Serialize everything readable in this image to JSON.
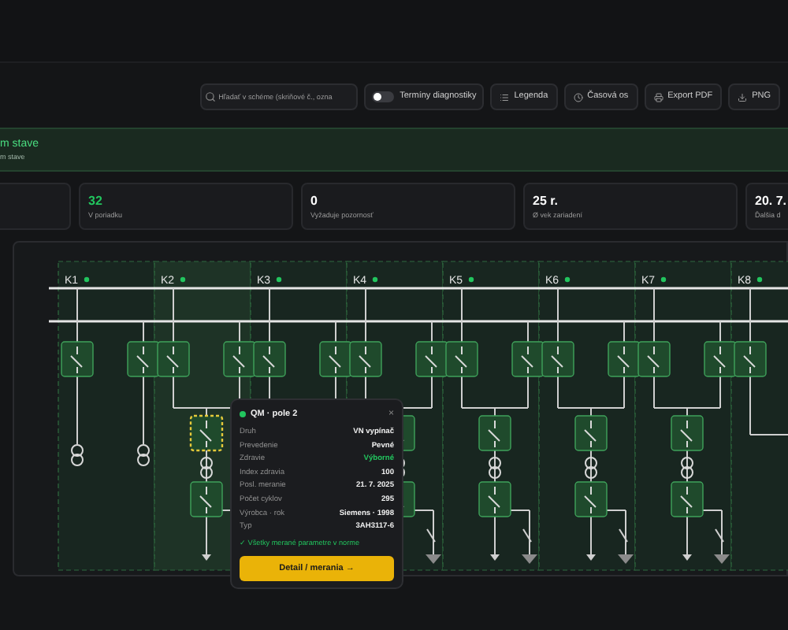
{
  "toolbar": {
    "search": {
      "placeholder": "Hľadať v schéme (skriňové č., ozna"
    },
    "toggle": {
      "label": "Termíny diagnostiky",
      "on": false
    },
    "buttons": [
      {
        "label": "Legenda"
      },
      {
        "label": "Časová os"
      },
      {
        "label": "Export PDF"
      },
      {
        "label": "PNG"
      }
    ]
  },
  "banner": {
    "title": "m stave",
    "subtitle": "m stave"
  },
  "stats": [
    {
      "value": "32",
      "label": "V poriadku",
      "kind": "good"
    },
    {
      "value": "0",
      "label": "Vyžaduje pozornosť",
      "kind": "plain"
    },
    {
      "value": "25 r.",
      "label": "Ø vek zariadení",
      "kind": "plain"
    },
    {
      "value": "20. 7.",
      "label": "Ďalšia d",
      "kind": "plain"
    }
  ],
  "schematic": {
    "bays": [
      {
        "label": "K1",
        "kind": "measurement",
        "color": "#22c55e",
        "selected": false
      },
      {
        "label": "K2",
        "kind": "feeder",
        "color": "#22c55e",
        "selected": true
      },
      {
        "label": "K3",
        "kind": "feeder",
        "color": "#22c55e",
        "selected": false
      },
      {
        "label": "K4",
        "kind": "feeder",
        "color": "#22c55e",
        "selected": false
      },
      {
        "label": "K5",
        "kind": "feeder",
        "color": "#22c55e",
        "selected": false
      },
      {
        "label": "K6",
        "kind": "feeder",
        "color": "#22c55e",
        "selected": false
      },
      {
        "label": "K7",
        "kind": "feeder",
        "color": "#22c55e",
        "selected": false
      },
      {
        "label": "K8",
        "kind": "coupler",
        "color": "#22c55e",
        "selected": false
      }
    ]
  },
  "popup": {
    "title": "QM · pole 2",
    "close": "×",
    "rows": [
      {
        "label": "Druh",
        "value": "VN vypínač",
        "kind": "plain"
      },
      {
        "label": "Prevedenie",
        "value": "Pevné",
        "kind": "plain"
      },
      {
        "label": "Zdravie",
        "value": "Výborné",
        "kind": "good"
      },
      {
        "label": "Index zdravia",
        "value": "100",
        "kind": "plain"
      },
      {
        "label": "Posl. meranie",
        "value": "21. 7. 2025",
        "kind": "plain"
      },
      {
        "label": "Počet cyklov",
        "value": "295",
        "kind": "plain"
      },
      {
        "label": "Výrobca · rok",
        "value": "Siemens · 1998",
        "kind": "plain"
      },
      {
        "label": "Typ",
        "value": "3AH3117-6",
        "kind": "plain"
      }
    ],
    "note": "✓ Všetky merané parametre v norme",
    "action": "Detail / merania →"
  }
}
